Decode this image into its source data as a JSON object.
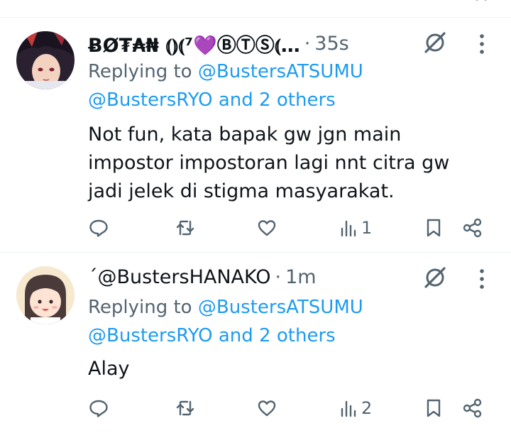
{
  "tweets": [
    {
      "display_name": "ɃØ₮₳₦ ⦅⦆⦅⁷💜ⒷⓉⓈ⦅…",
      "separator": "·",
      "time": "35s",
      "replying_prefix": "Replying to",
      "reply_to_1": "@BustersATSUMU",
      "reply_to_2": "@BustersRYO and 2 others",
      "text": "Not fun, kata bapak gw jgn main impostor impostoran lagi nnt citra gw jadi jelek di stigma masyarakat.",
      "views": "1",
      "avatar_colors": [
        "#2b2030",
        "#c43b3b",
        "#f4d2c0"
      ]
    },
    {
      "handle": "ˊ@BustersHANAKO",
      "separator": "·",
      "time": "1m",
      "replying_prefix": "Replying to",
      "reply_to_1": "@BustersATSUMU",
      "reply_to_2": "@BustersRYO and 2 others",
      "text": "Alay",
      "views": "2",
      "avatar_colors": [
        "#f6e9cf",
        "#4a3a3a",
        "#ffffff"
      ]
    }
  ],
  "icons": {
    "reply": "reply-icon",
    "retweet": "retweet-icon",
    "like": "like-icon",
    "views": "views-icon",
    "bookmark": "bookmark-icon",
    "share": "share-icon",
    "grok": "grok-icon",
    "more": "more-icon"
  },
  "colors": {
    "link": "#1d9bf0",
    "muted": "#536471",
    "text": "#0f1419",
    "divider": "#eff3f4"
  }
}
